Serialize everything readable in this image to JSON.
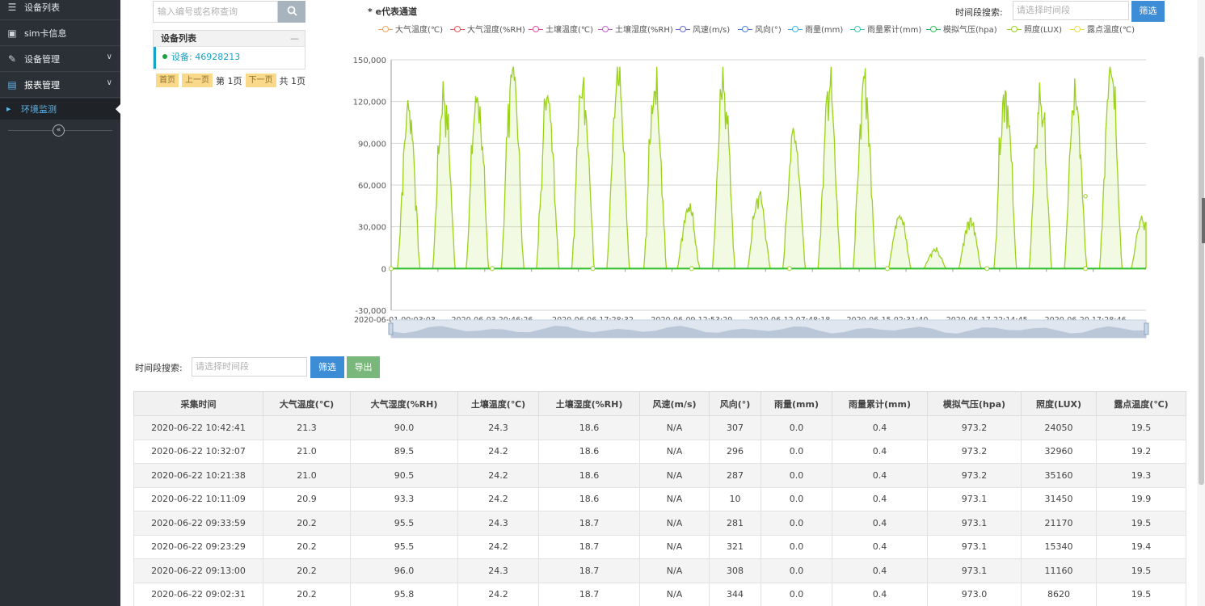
{
  "sidebar": {
    "items": [
      {
        "label": "设备列表",
        "icon": "list-icon"
      },
      {
        "label": "sim卡信息",
        "icon": "save-icon"
      },
      {
        "label": "设备管理",
        "icon": "wrench-icon"
      },
      {
        "label": "报表管理",
        "icon": "report-icon"
      }
    ],
    "sub_item": "环境监测",
    "collapse_symbol": "«"
  },
  "device_panel": {
    "search_placeholder": "输入编号或名称查询",
    "title": "设备列表",
    "minimize": "—",
    "device_label": "设备: 46928213",
    "pager": {
      "first": "首页",
      "prev": "上一页",
      "current": "第 1页",
      "next": "下一页",
      "total": "共 1页"
    }
  },
  "chart_header": {
    "title": "* e代表通道",
    "time_label": "时间段搜索:",
    "time_placeholder": "请选择时间段",
    "filter_label": "筛选"
  },
  "table_toolbar": {
    "time_label": "时间段搜索:",
    "time_placeholder": "请选择时间段",
    "filter_label": "筛选",
    "export_label": "导出"
  },
  "colors": {
    "sidebar_bg": "#2a3036",
    "primary_blue": "#3c8dd6",
    "export_green": "#79b77b",
    "illuminance_line": "#9bd21a",
    "flat_line": "#2fbf2f"
  },
  "chart_data": {
    "type": "line",
    "legend": [
      {
        "name": "大气温度(℃)",
        "color": "#f4a460"
      },
      {
        "name": "大气湿度(%RH)",
        "color": "#e65a5a"
      },
      {
        "name": "土壤温度(℃)",
        "color": "#e94c9a"
      },
      {
        "name": "土壤湿度(%RH)",
        "color": "#c85fd0"
      },
      {
        "name": "风速(m/s)",
        "color": "#6a6ad6"
      },
      {
        "name": "风向(°)",
        "color": "#4a7fe0"
      },
      {
        "name": "雨量(mm)",
        "color": "#3ab5e6"
      },
      {
        "name": "雨量累计(mm)",
        "color": "#40c8b0"
      },
      {
        "name": "模拟气压(hpa)",
        "color": "#2fbf5a"
      },
      {
        "name": "照度(LUX)",
        "color": "#9bd21a"
      },
      {
        "name": "露点温度(℃)",
        "color": "#e8e04a"
      }
    ],
    "y_ticks": [
      "150,000",
      "120,000",
      "90,000",
      "60,000",
      "30,000",
      "0",
      "-30,000"
    ],
    "ylim": [
      -30000,
      150000
    ],
    "x_ticks": [
      "2020-06-01 00:03:03",
      "2020-06-03 20:46:26",
      "2020-06-06 17:28:32",
      "2020-06-09 12:53:29",
      "2020-06-12 07:48:18",
      "2020-06-15 02:31:40",
      "2020-06-17 22:14:45",
      "2020-06-20 17:28:46"
    ],
    "xlim_days": [
      0,
      21.45
    ],
    "series": [
      {
        "name": "照度(LUX)",
        "peaks": [
          {
            "day": 0.5,
            "value": 114000
          },
          {
            "day": 1.5,
            "value": 121000
          },
          {
            "day": 2.45,
            "value": 123000
          },
          {
            "day": 3.45,
            "value": 143000
          },
          {
            "day": 4.45,
            "value": 124000
          },
          {
            "day": 5.45,
            "value": 132000
          },
          {
            "day": 6.45,
            "value": 132000
          },
          {
            "day": 7.5,
            "value": 127000
          },
          {
            "day": 8.45,
            "value": 44000
          },
          {
            "day": 9.45,
            "value": 128000
          },
          {
            "day": 10.45,
            "value": 52000
          },
          {
            "day": 11.45,
            "value": 97000
          },
          {
            "day": 12.45,
            "value": 126000
          },
          {
            "day": 13.45,
            "value": 137000
          },
          {
            "day": 14.45,
            "value": 38000
          },
          {
            "day": 15.45,
            "value": 13000
          },
          {
            "day": 16.45,
            "value": 36000
          },
          {
            "day": 17.45,
            "value": 128000
          },
          {
            "day": 18.45,
            "value": 119000
          },
          {
            "day": 19.45,
            "value": 122000
          },
          {
            "day": 20.45,
            "value": 141000
          },
          {
            "day": 21.35,
            "value": 35000
          }
        ]
      }
    ]
  },
  "table": {
    "headers": [
      "采集时间",
      "大气温度(℃)",
      "大气湿度(%RH)",
      "土壤温度(℃)",
      "土壤湿度(%RH)",
      "风速(m/s)",
      "风向(°)",
      "雨量(mm)",
      "雨量累计(mm)",
      "模拟气压(hpa)",
      "照度(LUX)",
      "露点温度(℃)"
    ],
    "rows": [
      [
        "2020-06-22 10:42:41",
        "21.3",
        "90.0",
        "24.3",
        "18.6",
        "N/A",
        "307",
        "0.0",
        "0.4",
        "973.2",
        "24050",
        "19.5"
      ],
      [
        "2020-06-22 10:32:07",
        "21.0",
        "89.5",
        "24.2",
        "18.6",
        "N/A",
        "296",
        "0.0",
        "0.4",
        "973.2",
        "32960",
        "19.2"
      ],
      [
        "2020-06-22 10:21:38",
        "21.0",
        "90.5",
        "24.2",
        "18.6",
        "N/A",
        "287",
        "0.0",
        "0.4",
        "973.2",
        "35160",
        "19.3"
      ],
      [
        "2020-06-22 10:11:09",
        "20.9",
        "93.3",
        "24.2",
        "18.6",
        "N/A",
        "10",
        "0.0",
        "0.4",
        "973.1",
        "31450",
        "19.9"
      ],
      [
        "2020-06-22 09:33:59",
        "20.2",
        "95.5",
        "24.3",
        "18.7",
        "N/A",
        "281",
        "0.0",
        "0.4",
        "973.1",
        "21170",
        "19.5"
      ],
      [
        "2020-06-22 09:23:29",
        "20.2",
        "95.5",
        "24.2",
        "18.7",
        "N/A",
        "321",
        "0.0",
        "0.4",
        "973.1",
        "15340",
        "19.4"
      ],
      [
        "2020-06-22 09:13:00",
        "20.2",
        "96.0",
        "24.3",
        "18.7",
        "N/A",
        "308",
        "0.0",
        "0.4",
        "973.1",
        "11160",
        "19.5"
      ],
      [
        "2020-06-22 09:02:31",
        "20.2",
        "95.8",
        "24.2",
        "18.7",
        "N/A",
        "344",
        "0.0",
        "0.4",
        "973.0",
        "8620",
        "19.5"
      ]
    ]
  }
}
